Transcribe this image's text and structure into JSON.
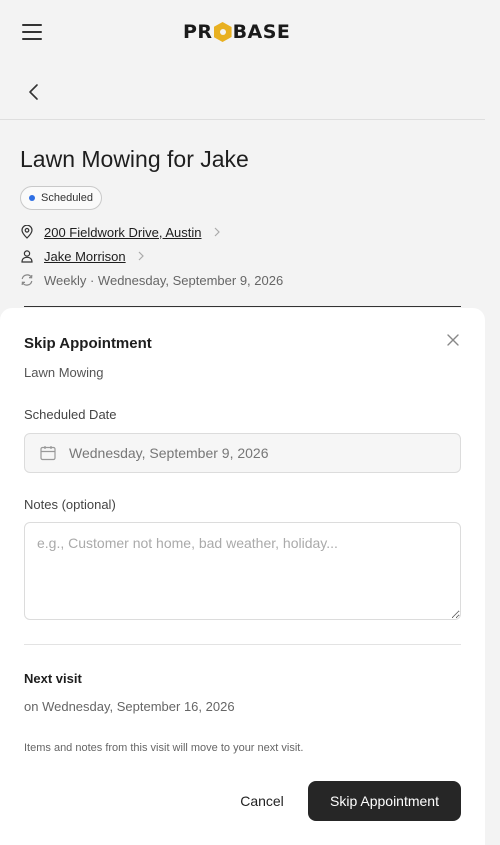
{
  "header": {
    "logo_left": "PR",
    "logo_right": "BASE"
  },
  "job": {
    "title": "Lawn Mowing for Jake",
    "status": "Scheduled",
    "address": "200 Fieldwork Drive, Austin",
    "customer": "Jake Morrison",
    "recurrence": "Weekly · Wednesday, September 9, 2026"
  },
  "modal": {
    "title": "Skip Appointment",
    "subtitle": "Lawn Mowing",
    "scheduled_label": "Scheduled Date",
    "scheduled_value": "Wednesday, September 9, 2026",
    "notes_label": "Notes (optional)",
    "notes_placeholder": "e.g., Customer not home, bad weather, holiday...",
    "notes_value": "",
    "next_label": "Next visit",
    "next_value": "on Wednesday, September 16, 2026",
    "hint": "Items and notes from this visit will move to your next visit.",
    "cancel_label": "Cancel",
    "confirm_label": "Skip Appointment"
  },
  "colors": {
    "status_dot": "#2f6fe4",
    "logo_accent": "#e8b021",
    "primary_button": "#262626"
  }
}
